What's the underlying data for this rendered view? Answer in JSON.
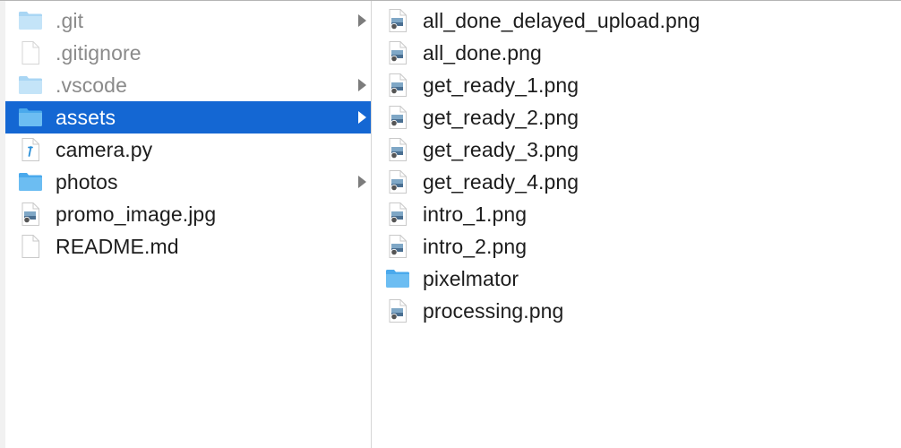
{
  "colors": {
    "selection": "#1467d3",
    "folder": "#6cbdf2",
    "folder_dim": "#b9def6",
    "text": "#1d1d1d",
    "text_dim": "#8a8a8a",
    "chevron": "#7c7c7c"
  },
  "column1": {
    "items": [
      {
        "label": ".git",
        "icon": "folder-icon",
        "has_children": true,
        "dimmed": true,
        "selected": false
      },
      {
        "label": ".gitignore",
        "icon": "document-icon",
        "has_children": false,
        "dimmed": true,
        "selected": false
      },
      {
        "label": ".vscode",
        "icon": "folder-icon",
        "has_children": true,
        "dimmed": true,
        "selected": false
      },
      {
        "label": "assets",
        "icon": "folder-icon",
        "has_children": true,
        "dimmed": false,
        "selected": true
      },
      {
        "label": "camera.py",
        "icon": "python-file-icon",
        "has_children": false,
        "dimmed": false,
        "selected": false
      },
      {
        "label": "photos",
        "icon": "folder-icon",
        "has_children": true,
        "dimmed": false,
        "selected": false
      },
      {
        "label": "promo_image.jpg",
        "icon": "image-file-icon",
        "has_children": false,
        "dimmed": false,
        "selected": false
      },
      {
        "label": "README.md",
        "icon": "document-icon",
        "has_children": false,
        "dimmed": false,
        "selected": false
      }
    ]
  },
  "column2": {
    "items": [
      {
        "label": "all_done_delayed_upload.png",
        "icon": "image-file-icon"
      },
      {
        "label": "all_done.png",
        "icon": "image-file-icon"
      },
      {
        "label": "get_ready_1.png",
        "icon": "image-file-icon"
      },
      {
        "label": "get_ready_2.png",
        "icon": "image-file-icon"
      },
      {
        "label": "get_ready_3.png",
        "icon": "image-file-icon"
      },
      {
        "label": "get_ready_4.png",
        "icon": "image-file-icon"
      },
      {
        "label": "intro_1.png",
        "icon": "image-file-icon"
      },
      {
        "label": "intro_2.png",
        "icon": "image-file-icon"
      },
      {
        "label": "pixelmator",
        "icon": "folder-icon"
      },
      {
        "label": "processing.png",
        "icon": "image-file-icon"
      }
    ]
  }
}
